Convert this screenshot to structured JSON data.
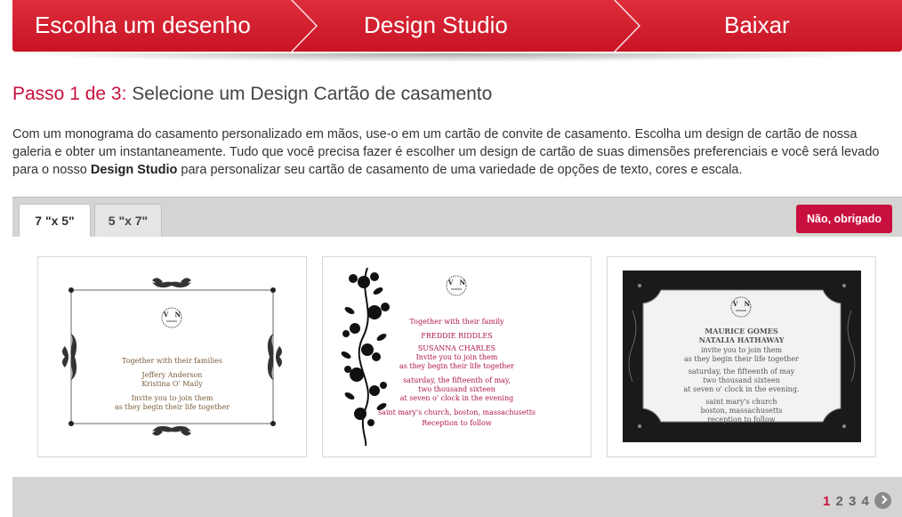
{
  "steps": {
    "step1": "Escolha um desenho",
    "step2": "Design Studio",
    "step3": "Baixar"
  },
  "heading": {
    "step_label": "Passo 1 de 3:",
    "title": "Selecione um Design Cartão de casamento"
  },
  "intro": {
    "text_before": "Com um monograma do casamento personalizado em mãos, use-o em um cartão de convite de casamento. Escolha um design de cartão de nossa galeria e obter um instantaneamente. Tudo que você precisa fazer é escolher um design de cartão de suas dimensões preferenciais e você será levado para o nosso ",
    "bold": "Design Studio",
    "text_after": " para personalizar seu cartão de casamento de uma variedade de opções de texto, cores e escala."
  },
  "tabs": [
    {
      "label": "7 \"x 5\"",
      "active": true
    },
    {
      "label": "5 \"x 7\"",
      "active": false
    }
  ],
  "no_thanks_label": "Não, obrigado",
  "monogram": {
    "left": "V",
    "right": "N"
  },
  "cards": [
    {
      "lines": [
        "Together with their families",
        "Jeffery Anderson",
        "Kristina O' Maily",
        "Invite you to join them",
        "as they begin their life together"
      ]
    },
    {
      "lines": [
        "Together with their family",
        "FREDDIE RIDDLES",
        "SUSANNA CHARLES",
        "Invite you to join them",
        "as they begin their life together",
        "saturday, the fifteenth of may,",
        "two thousand sixteen",
        "at seven o' clock in the evening",
        "saint mary's church, boston, massachusetts",
        "Reception to follow"
      ]
    },
    {
      "lines": [
        "MAURICE GOMES",
        "NATALIA HATHAWAY",
        "invite you to join them",
        "as they begin their life together",
        "saturday, the fifteenth of may",
        "two thousand sixteen",
        "at seven o' clock in the evening.",
        "saint mary's church",
        "boston, massachusetts",
        "reception to follow"
      ]
    }
  ],
  "pagination": {
    "pages": [
      "1",
      "2",
      "3",
      "4"
    ],
    "current": "1"
  },
  "colors": {
    "brand_red": "#c8103e",
    "step_bar": "#d41f30",
    "card_pink": "#b0174a"
  }
}
